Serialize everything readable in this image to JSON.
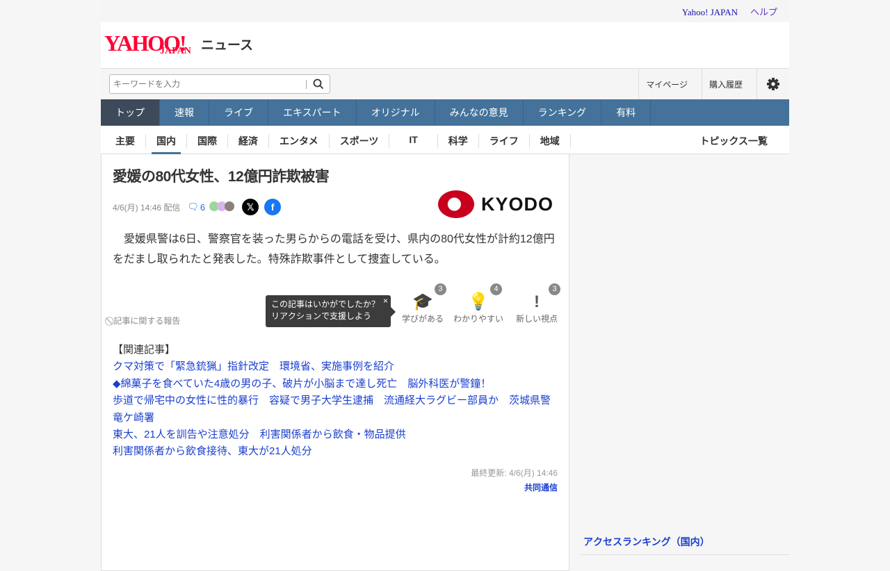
{
  "topbar": {
    "yahoo": "Yahoo! JAPAN",
    "help": "ヘルプ"
  },
  "logo": {
    "yahoo": "YAHOO!",
    "japan": "JAPAN",
    "news": "ニュース"
  },
  "search": {
    "placeholder": "キーワードを入力"
  },
  "header_links": {
    "mypage": "マイページ",
    "history": "購入履歴"
  },
  "nav": [
    "トップ",
    "速報",
    "ライブ",
    "エキスパート",
    "オリジナル",
    "みんなの意見",
    "ランキング",
    "有料"
  ],
  "subnav": [
    "主要",
    "国内",
    "国際",
    "経済",
    "エンタメ",
    "スポーツ",
    "IT",
    "科学",
    "ライフ",
    "地域"
  ],
  "topics_link": "トピックス一覧",
  "article": {
    "title": "愛媛の80代女性、12億円詐欺被害",
    "date": "4/6(月) 14:46 配信",
    "comments": "6",
    "publisher_logo": "KYODO",
    "body": "愛媛県警は6日、警察官を装った男らからの電話を受け、県内の80代女性が計約12億円をだまし取られたと発表した。特殊詐欺事件として捜査している。",
    "report": "記事に関する報告",
    "tooltip": [
      "この記事はいかがでしたか？",
      "リアクションで支援しよう"
    ],
    "reactions": [
      {
        "label": "学びがある",
        "count": "3"
      },
      {
        "label": "わかりやすい",
        "count": "4"
      },
      {
        "label": "新しい視点",
        "count": "3"
      }
    ],
    "related_heading": "【関連記事】",
    "related": [
      "クマ対策で「緊急銃猟」指針改定　環境省、実施事例を紹介",
      "◆綿菓子を食べていた4歳の男の子、破片が小脳まで達し死亡　脳外科医が警鐘！",
      "歩道で帰宅中の女性に性的暴行　容疑で男子大学生逮捕　流通経大ラグビー部員か　茨城県警竜ケ崎署",
      "東大、21人を訓告や注意処分　利害関係者から飲食・物品提供",
      "利害関係者から飲食接待、東大が21人処分"
    ],
    "updated": "最終更新: 4/6(月) 14:46",
    "source": "共同通信"
  },
  "sidebar": {
    "ranking_title": "アクセスランキング（国内）"
  }
}
